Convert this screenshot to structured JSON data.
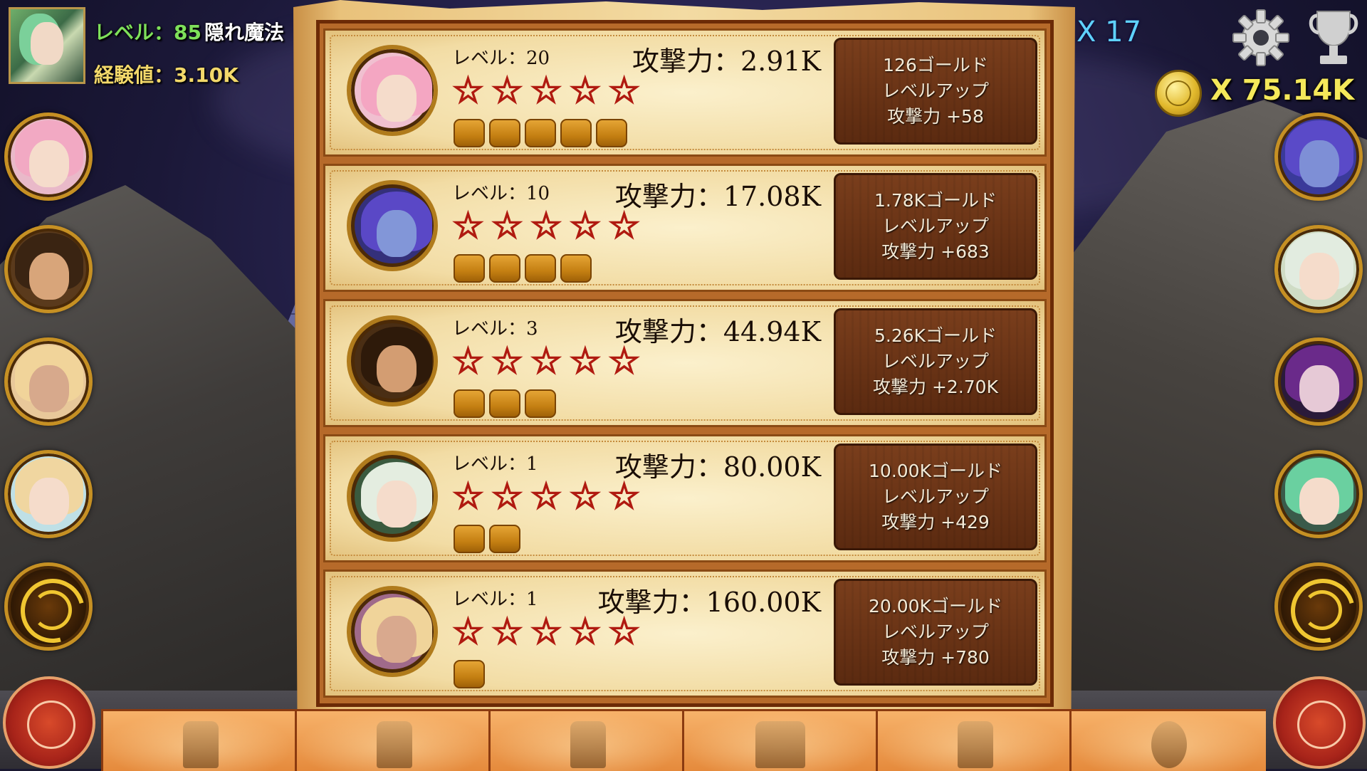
{
  "hud": {
    "level_label": "レベル：",
    "level_value": "85",
    "title": "隠れ魔法",
    "exp_label": "経験値：",
    "exp_value": "3.10K",
    "gem_count": "X 17",
    "gold_count": "X 75.14K"
  },
  "colors": {
    "gem_text": "#5fd2ff",
    "gold_text": "#f4e85a",
    "level_text": "#7ee05a",
    "star_outline": "#b01a10"
  },
  "icons": [
    "settings-gear-icon",
    "trophy-icon",
    "gold-coin-icon",
    "compass-icon"
  ],
  "rows": [
    {
      "level": "レベル：20",
      "attack": "攻撃力：2.91K",
      "stars": "☆☆☆☆☆",
      "pips": 5,
      "cost": "126ゴールド",
      "action": "レベルアップ",
      "bonus": "攻撃力 +58"
    },
    {
      "level": "レベル：10",
      "attack": "攻撃力：17.08K",
      "stars": "☆☆☆☆☆",
      "pips": 4,
      "cost": "1.78Kゴールド",
      "action": "レベルアップ",
      "bonus": "攻撃力 +683"
    },
    {
      "level": "レベル：3",
      "attack": "攻撃力：44.94K",
      "stars": "☆☆☆☆☆",
      "pips": 3,
      "cost": "5.26Kゴールド",
      "action": "レベルアップ",
      "bonus": "攻撃力 +2.70K"
    },
    {
      "level": "レベル：1",
      "attack": "攻撃力：80.00K",
      "stars": "☆☆☆☆☆",
      "pips": 2,
      "cost": "10.00Kゴールド",
      "action": "レベルアップ",
      "bonus": "攻撃力 +429"
    },
    {
      "level": "レベル：1",
      "attack": "攻撃力：160.00K",
      "stars": "☆☆☆☆☆",
      "pips": 1,
      "cost": "20.00Kゴールド",
      "action": "レベルアップ",
      "bonus": "攻撃力 +780"
    }
  ],
  "tabs": [
    "heroine-tab",
    "fairy-tab",
    "potion-tab",
    "chest-tab",
    "bag-tab",
    "gem-tab"
  ]
}
